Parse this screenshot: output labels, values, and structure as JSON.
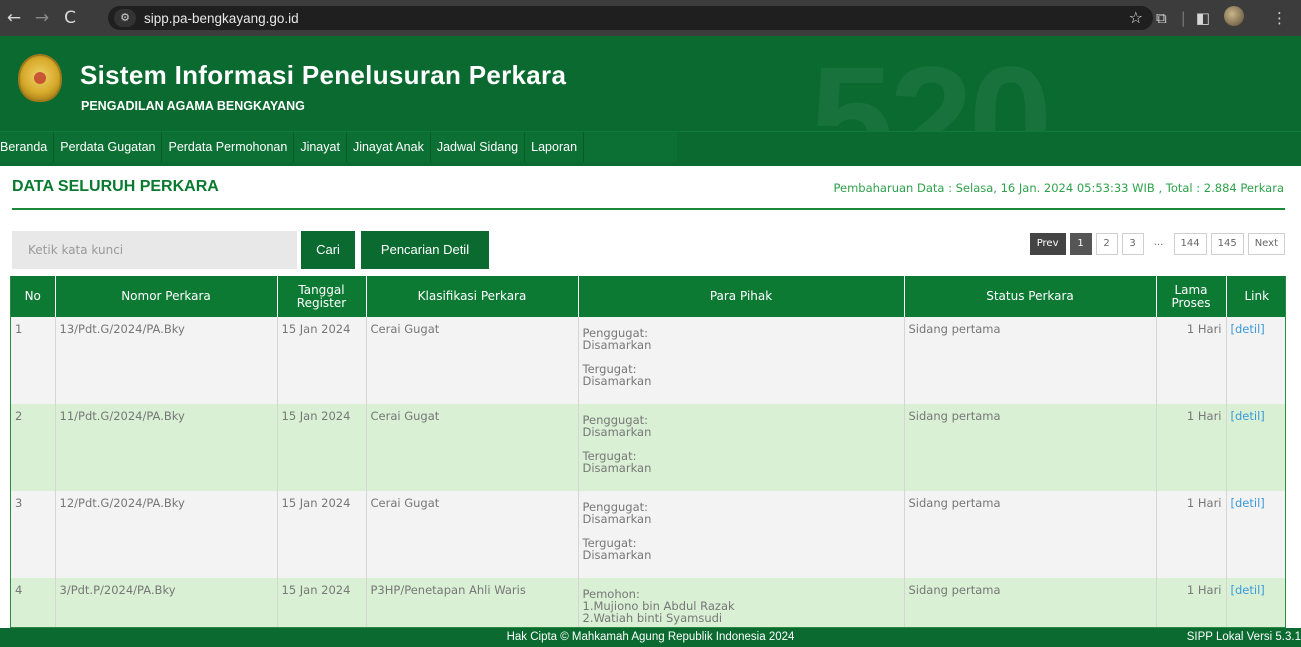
{
  "browser": {
    "url": "sipp.pa-bengkayang.go.id",
    "back_icon": "←",
    "forward_icon": "→",
    "reload_icon": "C",
    "star_icon": "☆"
  },
  "header": {
    "title": "Sistem Informasi Penelusuran Perkara",
    "subtitle": "PENGADILAN AGAMA BENGKAYANG",
    "watermark": "520"
  },
  "menu": {
    "items": [
      {
        "label": "Beranda"
      },
      {
        "label": "Perdata Gugatan"
      },
      {
        "label": "Perdata Permohonan"
      },
      {
        "label": "Jinayat"
      },
      {
        "label": "Jinayat Anak"
      },
      {
        "label": "Jadwal Sidang"
      },
      {
        "label": "Laporan"
      }
    ]
  },
  "page": {
    "title": "DATA SELURUH PERKARA",
    "update_info": "Pembaharuan Data : Selasa, 16 Jan. 2024 05:53:33 WIB , Total : 2.884 Perkara"
  },
  "search": {
    "placeholder": "Ketik kata kunci",
    "search_label": "Cari",
    "detail_label": "Pencarian Detil"
  },
  "pagination": {
    "prev": "Prev",
    "pages": [
      "1",
      "2",
      "3"
    ],
    "dots": "...",
    "tail_pages": [
      "144",
      "145"
    ],
    "next": "Next",
    "current": "1"
  },
  "table": {
    "columns": [
      "No",
      "Nomor Perkara",
      "Tanggal Register",
      "Klasifikasi Perkara",
      "Para Pihak",
      "Status Perkara",
      "Lama Proses",
      "Link"
    ],
    "col_tanggal_l1": "Tanggal",
    "col_tanggal_l2": "Register",
    "col_lama_l1": "Lama",
    "col_lama_l2": "Proses",
    "rows": [
      {
        "no": "1",
        "nomor": "13/Pdt.G/2024/PA.Bky",
        "tanggal": "15 Jan 2024",
        "klasifikasi": "Cerai Gugat",
        "pihak1_label": "Penggugat:",
        "pihak1_value": "Disamarkan",
        "pihak2_label": "Tergugat:",
        "pihak2_value": "Disamarkan",
        "status": "Sidang pertama",
        "lama": "1 Hari",
        "link": "[detil]"
      },
      {
        "no": "2",
        "nomor": "11/Pdt.G/2024/PA.Bky",
        "tanggal": "15 Jan 2024",
        "klasifikasi": "Cerai Gugat",
        "pihak1_label": "Penggugat:",
        "pihak1_value": "Disamarkan",
        "pihak2_label": "Tergugat:",
        "pihak2_value": "Disamarkan",
        "status": "Sidang pertama",
        "lama": "1 Hari",
        "link": "[detil]"
      },
      {
        "no": "3",
        "nomor": "12/Pdt.G/2024/PA.Bky",
        "tanggal": "15 Jan 2024",
        "klasifikasi": "Cerai Gugat",
        "pihak1_label": "Penggugat:",
        "pihak1_value": "Disamarkan",
        "pihak2_label": "Tergugat:",
        "pihak2_value": "Disamarkan",
        "status": "Sidang pertama",
        "lama": "1 Hari",
        "link": "[detil]"
      },
      {
        "no": "4",
        "nomor": "3/Pdt.P/2024/PA.Bky",
        "tanggal": "15 Jan 2024",
        "klasifikasi": "P3HP/Penetapan Ahli Waris",
        "pihak1_label": "Pemohon:",
        "pihak1_value": "1.Mujiono bin Abdul Razak",
        "pihak1_value2": "2.Watiah binti Syamsudi",
        "status": "Sidang pertama",
        "lama": "1 Hari",
        "link": "[detil]"
      }
    ]
  },
  "footer": {
    "copyright": "Hak Cipta © Mahkamah Agung Republik Indonesia 2024",
    "version": "SIPP Lokal Versi 5.3.1"
  },
  "colors": {
    "primary_green": "#0a6a2f",
    "header_green": "#0d7a34",
    "row_alt": "#d9f0d5",
    "link_blue": "#3a9ad9"
  }
}
